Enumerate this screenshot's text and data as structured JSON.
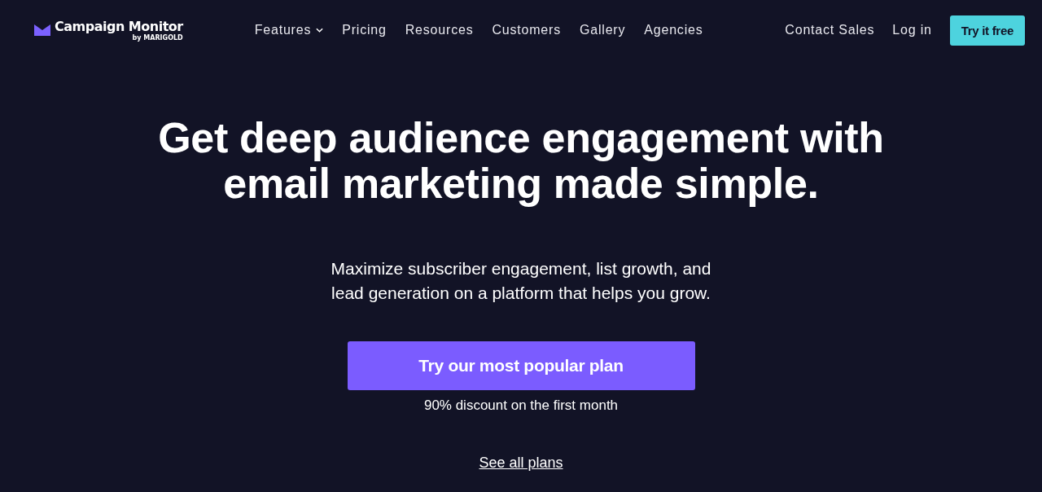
{
  "logo": {
    "name": "Campaign Monitor",
    "byline": "by MARIGOLD"
  },
  "nav": [
    {
      "label": "Features",
      "dropdown": true
    },
    {
      "label": "Pricing",
      "dropdown": false
    },
    {
      "label": "Resources",
      "dropdown": false
    },
    {
      "label": "Customers",
      "dropdown": false
    },
    {
      "label": "Gallery",
      "dropdown": false
    },
    {
      "label": "Agencies",
      "dropdown": false
    }
  ],
  "nav_right": [
    {
      "label": "Contact Sales",
      "kind": "link"
    },
    {
      "label": "Log in",
      "kind": "link"
    },
    {
      "label": "Try it free",
      "kind": "button"
    }
  ],
  "hero": {
    "title": "Get deep audience engagement with email marketing made simple.",
    "subtitle": "Maximize subscriber engagement, list growth, and lead generation on a platform that helps you grow.",
    "cta": "Try our most popular plan",
    "cta_note": "90% discount on the first month",
    "link": "See all plans"
  }
}
